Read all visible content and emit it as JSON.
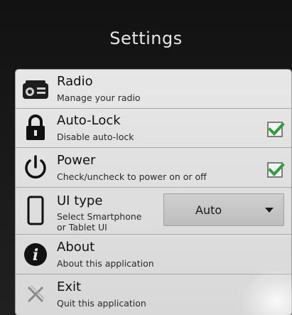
{
  "header": {
    "title": "Settings"
  },
  "settings": {
    "items": [
      {
        "id": "radio",
        "icon": "radio-icon",
        "title": "Radio",
        "subtitle": "Manage your radio"
      },
      {
        "id": "auto-lock",
        "icon": "lock-icon",
        "title": "Auto-Lock",
        "subtitle": "Disable auto-lock",
        "checked": true
      },
      {
        "id": "power",
        "icon": "power-icon",
        "title": "Power",
        "subtitle": "Check/uncheck to power on or off",
        "checked": true
      },
      {
        "id": "ui-type",
        "icon": "smartphone-icon",
        "title": "UI type",
        "subtitle_line1": "Select Smartphone",
        "subtitle_line2": "or Tablet UI",
        "selected": "Auto"
      },
      {
        "id": "about",
        "icon": "info-icon",
        "title": "About",
        "subtitle": "About this application"
      },
      {
        "id": "exit",
        "icon": "exit-icon",
        "title": "Exit",
        "subtitle": "Quit this application"
      }
    ]
  },
  "colors": {
    "panel_bg": "#e2e2e2",
    "check_green": "#2f9e3a",
    "screen_bg": "#151515"
  }
}
